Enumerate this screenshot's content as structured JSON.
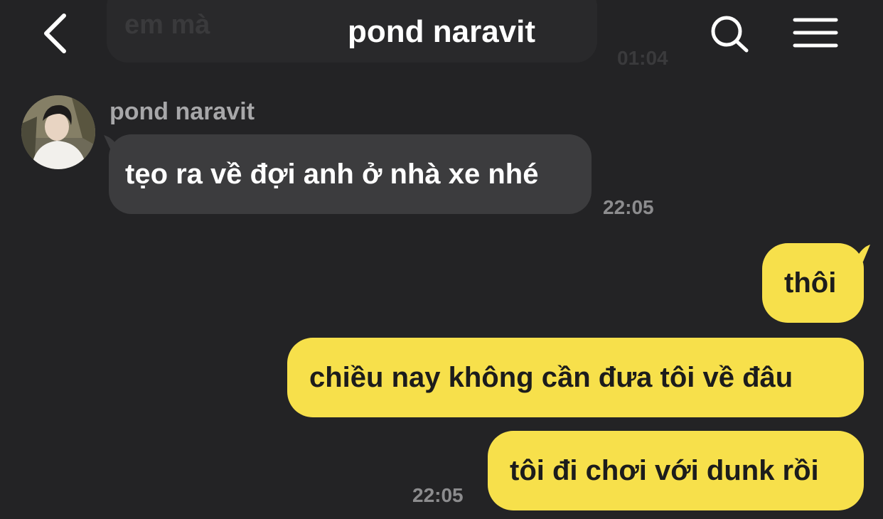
{
  "app": {
    "accent_color": "#f7e04b",
    "background_color": "#232325",
    "incoming_bubble_color": "#3c3c3e"
  },
  "ghost": {
    "text": "em mà",
    "time": "01:04"
  },
  "header": {
    "title": "pond naravit",
    "back_icon": "chevron-left-icon",
    "search_icon": "search-icon",
    "menu_icon": "hamburger-menu-icon"
  },
  "messages": {
    "incoming": {
      "sender": "pond naravit",
      "text": "tẹo ra về đợi anh ở nhà xe nhé",
      "time": "22:05"
    },
    "outgoing": [
      {
        "text": "thôi"
      },
      {
        "text": "chiều nay không cần đưa tôi về đâu"
      },
      {
        "text": "tôi đi chơi với dunk rồi"
      }
    ],
    "outgoing_time": "22:05"
  }
}
